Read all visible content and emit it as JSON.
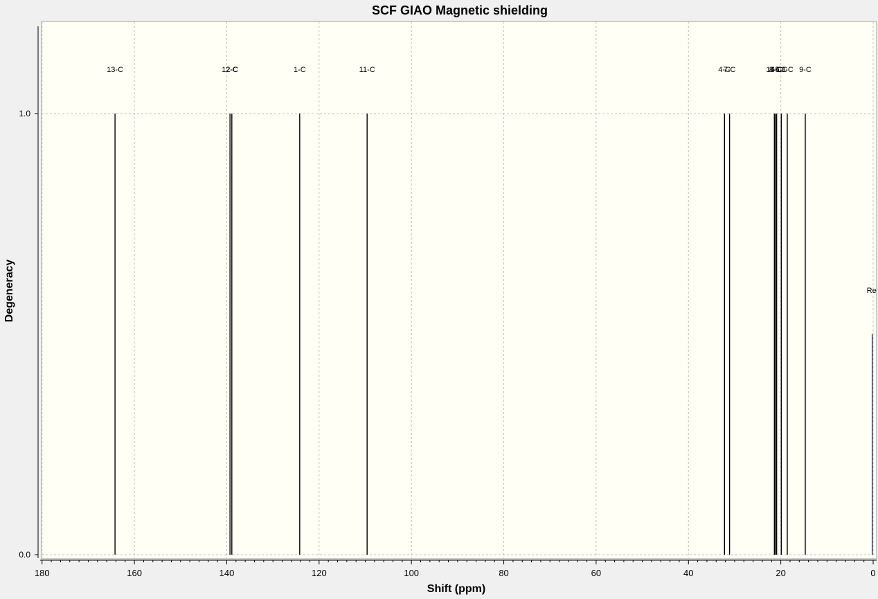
{
  "chart_data": {
    "type": "bar",
    "title": "SCF GIAO Magnetic shielding",
    "xlabel": "Shift (ppm)",
    "ylabel": "Degeneracy",
    "xlim": [
      180,
      0
    ],
    "ylim": [
      0,
      1.2
    ],
    "x_reversed": true,
    "grid": true,
    "x_ticks": [
      {
        "value": 180,
        "label": "180"
      },
      {
        "value": 160,
        "label": "160"
      },
      {
        "value": 140,
        "label": "140"
      },
      {
        "value": 120,
        "label": "120"
      },
      {
        "value": 100,
        "label": "100"
      },
      {
        "value": 80,
        "label": "80"
      },
      {
        "value": 60,
        "label": "60"
      },
      {
        "value": 40,
        "label": "40"
      },
      {
        "value": 20,
        "label": "20"
      },
      {
        "value": 0,
        "label": "0"
      }
    ],
    "y_ticks": [
      {
        "value": 0,
        "label": "0.0"
      },
      {
        "value": 1,
        "label": "1.0"
      }
    ],
    "peaks": [
      {
        "label": "13-C",
        "shift": 164.2,
        "degeneracy": 1
      },
      {
        "label": "12-C",
        "shift": 139.3,
        "degeneracy": 1
      },
      {
        "label": "2-C",
        "shift": 138.9,
        "degeneracy": 1
      },
      {
        "label": "1-C",
        "shift": 124.2,
        "degeneracy": 1
      },
      {
        "label": "11-C",
        "shift": 109.6,
        "degeneracy": 1
      },
      {
        "label": "4-C",
        "shift": 32.2,
        "degeneracy": 1
      },
      {
        "label": "7-C",
        "shift": 31.1,
        "degeneracy": 1
      },
      {
        "label": "14-C",
        "shift": 21.4,
        "degeneracy": 1
      },
      {
        "label": "8-C",
        "shift": 21.2,
        "degeneracy": 1
      },
      {
        "label": "6-C",
        "shift": 20.9,
        "degeneracy": 1
      },
      {
        "label": "5-C",
        "shift": 19.9,
        "degeneracy": 1
      },
      {
        "label": "3-C",
        "shift": 18.6,
        "degeneracy": 1
      },
      {
        "label": "9-C",
        "shift": 14.7,
        "degeneracy": 1
      }
    ],
    "reference": {
      "label": "Re",
      "shift": 0.2,
      "degeneracy": 0.5,
      "color": "#202078"
    },
    "colors": {
      "plot_background": "#fffff5",
      "window_background": "#f0f0f0",
      "peak_line": "#000000",
      "grid": "#c0c0c0"
    }
  }
}
